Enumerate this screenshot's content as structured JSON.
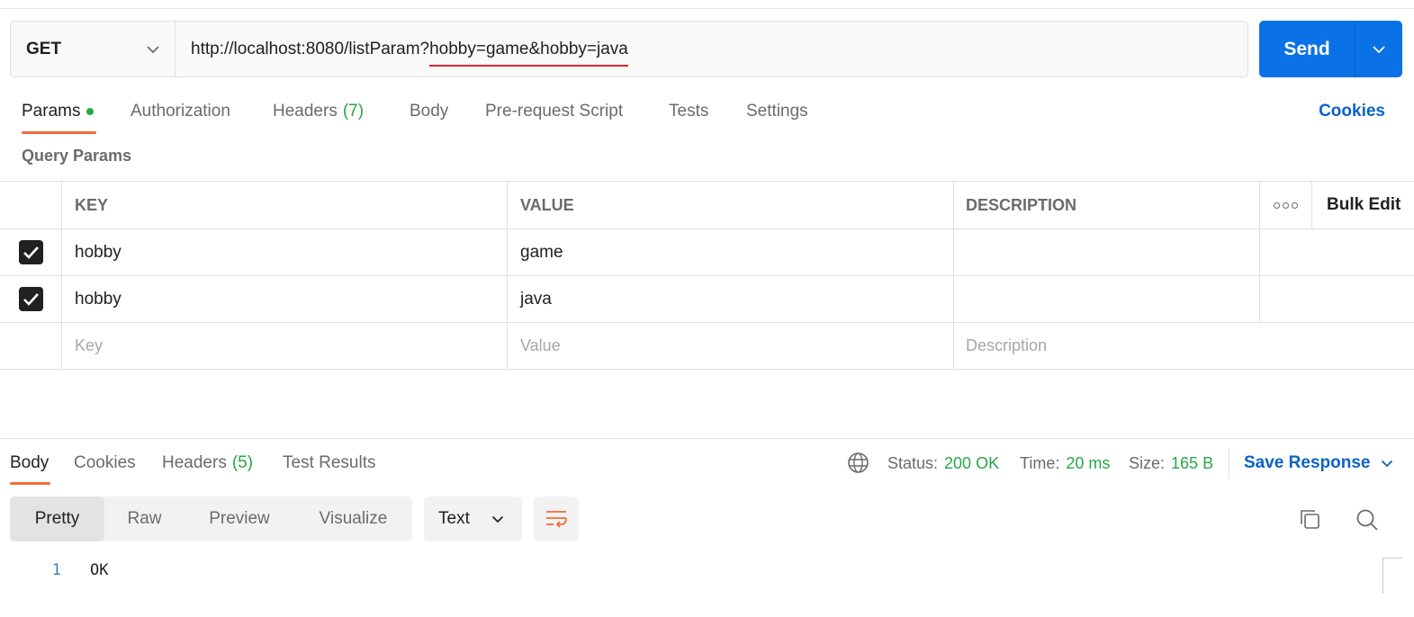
{
  "request": {
    "method": "GET",
    "url_base": "http://localhost:8080/listParam?",
    "url_query": "hobby=game&hobby=java",
    "send_label": "Send"
  },
  "request_tabs": [
    {
      "label": "Params",
      "active": true,
      "dot": true
    },
    {
      "label": "Authorization"
    },
    {
      "label": "Headers",
      "count": "(7)"
    },
    {
      "label": "Body"
    },
    {
      "label": "Pre-request Script"
    },
    {
      "label": "Tests"
    },
    {
      "label": "Settings"
    }
  ],
  "cookies_label": "Cookies",
  "query_params_label": "Query Params",
  "params_table": {
    "headers": {
      "key": "KEY",
      "value": "VALUE",
      "description": "DESCRIPTION",
      "bulk_edit": "Bulk Edit"
    },
    "rows": [
      {
        "checked": true,
        "key": "hobby",
        "value": "game",
        "description": ""
      },
      {
        "checked": true,
        "key": "hobby",
        "value": "java",
        "description": ""
      }
    ],
    "placeholders": {
      "key": "Key",
      "value": "Value",
      "description": "Description"
    }
  },
  "response_tabs": [
    {
      "label": "Body",
      "active": true
    },
    {
      "label": "Cookies"
    },
    {
      "label": "Headers",
      "count": "(5)"
    },
    {
      "label": "Test Results"
    }
  ],
  "response_status": {
    "status_label": "Status:",
    "status_value": "200 OK",
    "time_label": "Time:",
    "time_value": "20 ms",
    "size_label": "Size:",
    "size_value": "165 B",
    "save_response": "Save Response"
  },
  "view_modes": [
    "Pretty",
    "Raw",
    "Preview",
    "Visualize"
  ],
  "format": "Text",
  "response_body": [
    {
      "line": "1",
      "text": "OK"
    }
  ],
  "colors": {
    "accent": "#0a72e6",
    "active_tab": "#f26b3a",
    "success": "#28a745",
    "link": "#0a62c9"
  },
  "icons": [
    "chevron-down-icon",
    "check-icon",
    "more-icon",
    "globe-icon",
    "wrap-lines-icon",
    "copy-icon",
    "search-icon"
  ]
}
